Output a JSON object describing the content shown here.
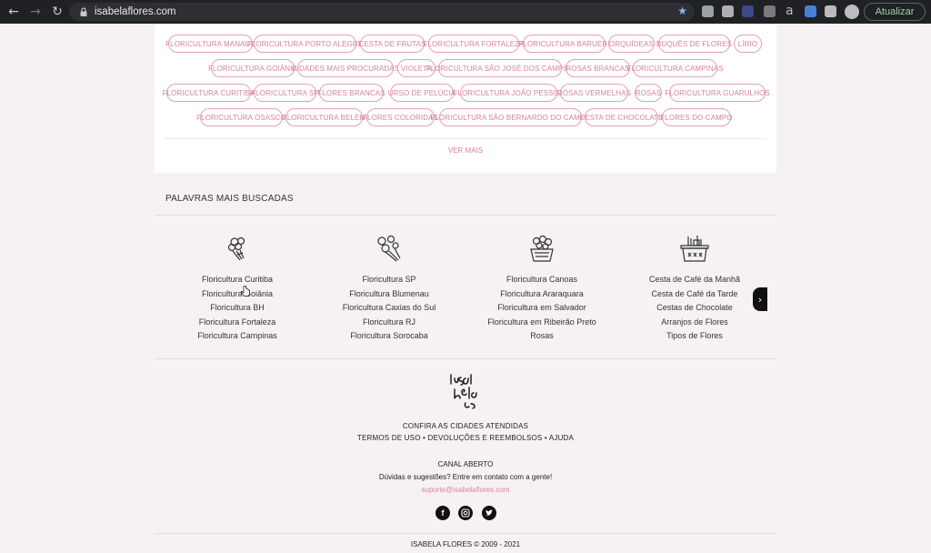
{
  "browser": {
    "url": "isabelaflores.com",
    "update_label": "Atualizar",
    "ext_letter": "a"
  },
  "tags": [
    "FLORICULTURA MANAUS",
    "FLORICULTURA PORTO ALEGRE",
    "CESTA DE FRUTAS",
    "FLORICULTURA FORTALEZA",
    "FLORICULTURA BARUERI",
    "ORQUÍDEAS",
    "BUQUÊS DE FLORES",
    "LÍRIO",
    "FLORICULTURA GOIÂNIA",
    "CIDADES MAIS PROCURADAS",
    "VIOLETA",
    "FLORICULTURA SÃO JOSÉ DOS CAMPOS",
    "ROSAS BRANCAS",
    "FLORICULTURA CAMPINAS",
    "FLORICULTURA CURITIBA",
    "FLORICULTURA SP",
    "FLORES BRANCAS",
    "URSO DE PELÚCIA",
    "FLORICULTURA JOÃO PESSOA",
    "ROSAS VERMELHAS",
    "ROSAS",
    "FLORICULTURA GUARULHOS",
    "FLORICULTURA OSASCO",
    "FLORICULTURA BELÉM",
    "FLORES COLORIDAS",
    "FLORICULTURA SÃO BERNARDO DO CAMPO",
    "CESTA DE CHOCOLATE",
    "FLORES DO CAMPO"
  ],
  "ver_mais": "VER MAIS",
  "most_searched": {
    "title": "PALAVRAS MAIS BUSCADAS",
    "columns": [
      {
        "icon": "bouquet-icon",
        "links": [
          "Floricultura Curitiba",
          "Floricultura Goiânia",
          "Floricultura BH",
          "Floricultura Fortaleza",
          "Floricultura Campinas"
        ]
      },
      {
        "icon": "flowers-icon",
        "links": [
          "Floricultura SP",
          "Floricultura Blumenau",
          "Floricultura Caxias do Sul",
          "Floricultura RJ",
          "Floricultura Sorocaba"
        ]
      },
      {
        "icon": "flower-basket-icon",
        "links": [
          "Floricultura Canoas",
          "Floricultura Araraquara",
          "Floricultura em Salvador",
          "Floricultura em Ribeirão Preto",
          "Rosas"
        ]
      },
      {
        "icon": "gift-basket-icon",
        "links": [
          "Cesta de Café da Manhã",
          "Cesta de Café da Tarde",
          "Cestas de Chocolate",
          "Arranjos de Flores",
          "Tipos de Flores"
        ]
      }
    ]
  },
  "footer": {
    "logo_text": "isabela flores",
    "cities": "CONFIRA AS CIDADES ATENDIDAS",
    "links_line": "TERMOS DE USO • DEVOLUÇÕES E REEMBOLSOS • AJUDA",
    "canal": "CANAL ABERTO",
    "question": "Dúvidas e sugestões? Entre em contato com a gente!",
    "email": "suporte@isabelaflores.com",
    "social": [
      "facebook-icon",
      "instagram-icon",
      "twitter-icon"
    ],
    "copyright": "ISABELA FLORES © 2009 - 2021"
  },
  "colors": {
    "accent_pink": "#d8839c",
    "tag_border": "#e3a1b4",
    "background": "#f6f2f3"
  }
}
